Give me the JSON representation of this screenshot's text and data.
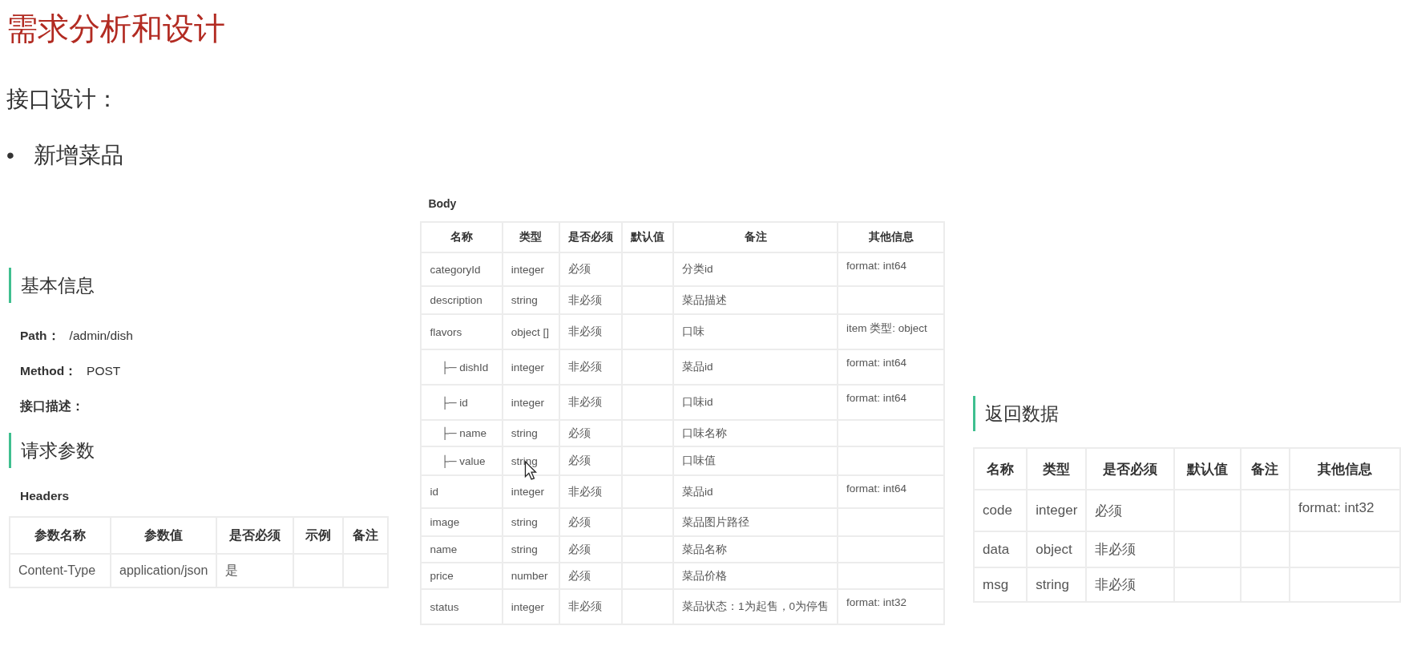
{
  "title": "需求分析和设计",
  "subtitle": "接口设计：",
  "bullet": {
    "marker": "•",
    "text": "新增菜品"
  },
  "basic_info": {
    "heading": "基本信息",
    "fields": [
      {
        "label": "Path：",
        "value": "/admin/dish"
      },
      {
        "label": "Method：",
        "value": "POST"
      },
      {
        "label": "接口描述："
      }
    ]
  },
  "request": {
    "heading": "请求参数",
    "headers_label": "Headers",
    "headers_table": {
      "columns": [
        "参数名称",
        "参数值",
        "是否必须",
        "示例",
        "备注"
      ],
      "rows": [
        {
          "cells": [
            "Content-Type",
            "application/json",
            "是",
            null,
            null
          ]
        }
      ]
    },
    "body_label": "Body",
    "body_table": {
      "columns": [
        "名称",
        "类型",
        "是否必须",
        "默认值",
        "备注",
        "其他信息"
      ],
      "rows": [
        {
          "cells": [
            "categoryId",
            "integer",
            "必须",
            null,
            "分类id",
            "format: int64"
          ]
        },
        {
          "cells": [
            "description",
            "string",
            "非必须",
            null,
            "菜品描述",
            null
          ]
        },
        {
          "cells": [
            "flavors",
            "object []",
            "非必须",
            null,
            "口味",
            "item 类型: object"
          ],
          "children": [
            {
              "cells": [
                "├─ dishId",
                "integer",
                "非必须",
                null,
                "菜品id",
                "format: int64"
              ]
            },
            {
              "cells": [
                "├─ id",
                "integer",
                "非必须",
                null,
                "口味id",
                "format: int64"
              ]
            },
            {
              "cells": [
                "├─ name",
                "string",
                "必须",
                null,
                "口味名称",
                null
              ]
            },
            {
              "cells": [
                "├─ value",
                "string",
                "必须",
                null,
                "口味值",
                null
              ]
            }
          ]
        },
        {
          "cells": [
            "id",
            "integer",
            "非必须",
            null,
            "菜品id",
            "format: int64"
          ]
        },
        {
          "cells": [
            "image",
            "string",
            "必须",
            null,
            "菜品图片路径",
            null
          ]
        },
        {
          "cells": [
            "name",
            "string",
            "必须",
            null,
            "菜品名称",
            null
          ]
        },
        {
          "cells": [
            "price",
            "number",
            "必须",
            null,
            "菜品价格",
            null
          ]
        },
        {
          "cells": [
            "status",
            "integer",
            "非必须",
            null,
            "菜品状态：1为起售，0为停售",
            "format: int32"
          ]
        }
      ]
    }
  },
  "response": {
    "heading": "返回数据",
    "table": {
      "columns": [
        "名称",
        "类型",
        "是否必须",
        "默认值",
        "备注",
        "其他信息"
      ],
      "rows": [
        {
          "cells": [
            "code",
            "integer",
            "必须",
            null,
            null,
            "format: int32"
          ]
        },
        {
          "cells": [
            "data",
            "object",
            "非必须",
            null,
            null,
            null
          ]
        },
        {
          "cells": [
            "msg",
            "string",
            "非必须",
            null,
            null,
            null
          ]
        }
      ]
    }
  }
}
